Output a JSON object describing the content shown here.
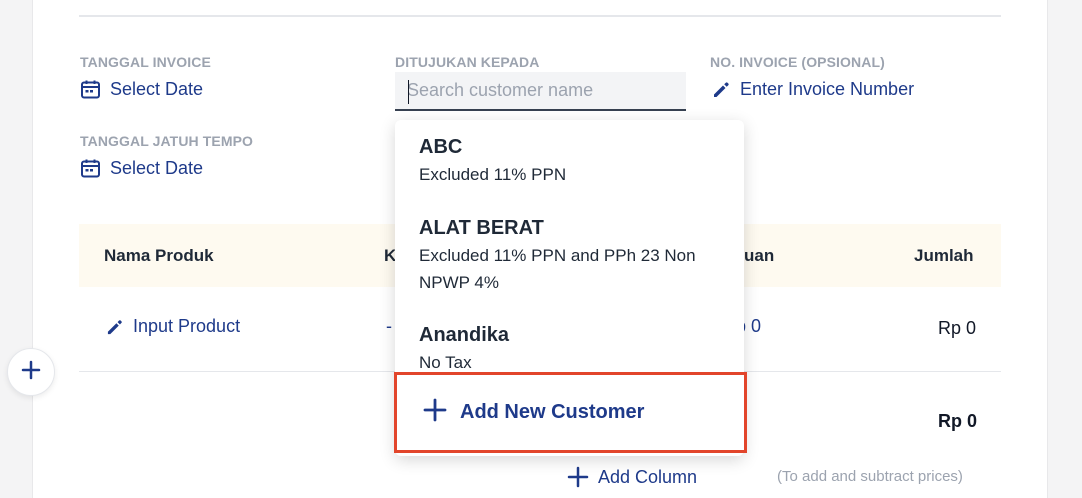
{
  "form": {
    "invoice_date": {
      "label": "TANGGAL INVOICE",
      "value": "Select Date",
      "icon": "calendar-icon"
    },
    "due_date": {
      "label": "TANGGAL JATUH TEMPO",
      "value": "Select Date",
      "icon": "calendar-icon"
    },
    "customer": {
      "label": "DITUJUKAN KEPADA",
      "placeholder": "Search customer name",
      "value": ""
    },
    "invoice_number": {
      "label": "NO. INVOICE (OPSIONAL)",
      "value": "Enter Invoice Number",
      "icon": "pencil-icon"
    }
  },
  "table": {
    "columns": [
      "Nama Produk",
      "K",
      "uan",
      "Jumlah"
    ],
    "rows": [
      {
        "product": "Input Product",
        "qty": "-",
        "price": "p 0",
        "amount": "Rp 0"
      }
    ],
    "total": "Rp 0",
    "add_column_label": "Add Column",
    "add_column_hint": "(To add and subtract prices)"
  },
  "customer_dropdown": {
    "items": [
      {
        "name": "ABC",
        "tax": "Excluded 11% PPN"
      },
      {
        "name": "ALAT BERAT",
        "tax": "Excluded 11% PPN and PPh 23 Non NPWP 4%"
      },
      {
        "name": "Anandika",
        "tax": "No Tax"
      }
    ],
    "add_new_label": "Add New Customer"
  },
  "colors": {
    "accent": "#1e3a8a",
    "highlight_border": "#e2452b",
    "muted_label": "#9ca3af",
    "table_header_bg": "#fefaf0"
  }
}
